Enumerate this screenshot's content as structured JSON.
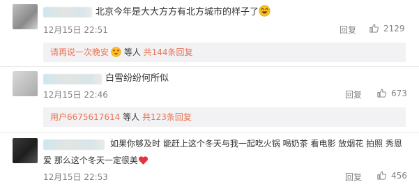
{
  "comments": [
    {
      "text": "北京今年是大大方方有北方城市的样子了",
      "time": "12月15日 22:51",
      "reply_label": "回复",
      "likes": "2129",
      "sub": {
        "lead": "请再说一次晚安",
        "suffix": " 等人 ",
        "count": "共144条回复"
      }
    },
    {
      "text": "白雪纷纷何所似",
      "time": "12月15日 22:46",
      "reply_label": "回复",
      "likes": "673",
      "sub": {
        "lead": "用户6675617614",
        "suffix": " 等人 ",
        "count": "共123条回复"
      }
    },
    {
      "text_line1": "如果你够及时 能赶上这个冬天与我一起吃火锅 喝奶茶 看电影 放烟花 拍照 秀恩",
      "text_line2": "爱 那么这个冬天一定很美",
      "time": "12月15日 22:53",
      "reply_label": "回复",
      "likes": "456"
    }
  ],
  "icons": {
    "like": "thumbs-up-icon",
    "emoji1": "laughing-face-icon",
    "emoji2": "heart-eyes-face-icon",
    "emoji3": "red-heart-icon"
  },
  "colors": {
    "link": "#eb7350",
    "meta": "#808080",
    "subbox_bg": "#f2f2f5"
  }
}
